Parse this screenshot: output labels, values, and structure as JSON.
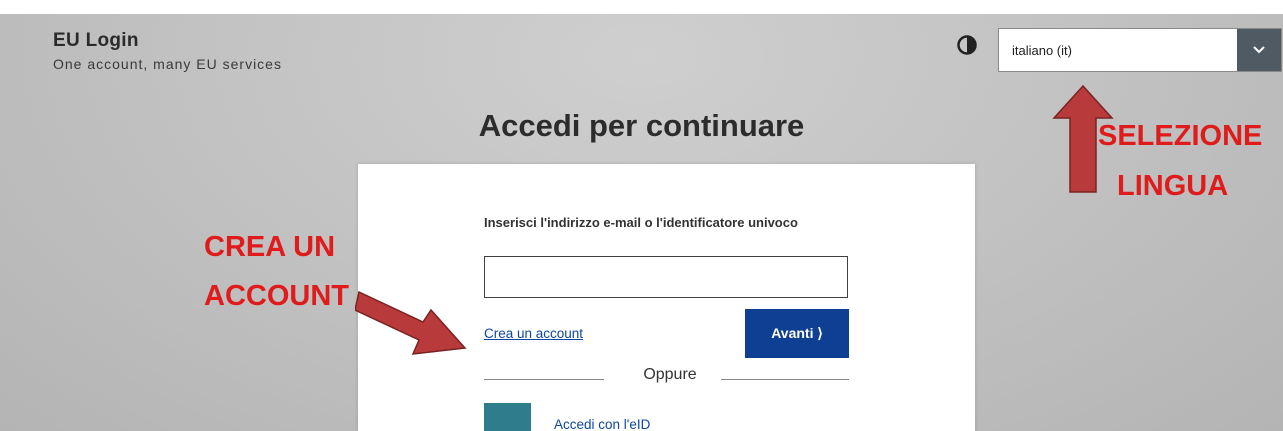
{
  "header": {
    "app_title": "EU Login",
    "tagline": "One account, many EU services",
    "contrast_icon": "contrast-icon",
    "language": {
      "selected": "italiano (it)",
      "icon": "chevron-down-icon"
    }
  },
  "main": {
    "heading": "Accedi per continuare",
    "login_card": {
      "field_label": "Inserisci l'indirizzo e-mail o l'identificatore univoco",
      "field_value": "",
      "create_account_link": "Crea un account",
      "next_button": "Avanti ⟩",
      "divider_text": "Oppure",
      "eid_icon": "globe-icon",
      "eid_link": "Accedi con l'eID"
    }
  },
  "annotations": {
    "create_account_line1": "CREA UN",
    "create_account_line2": "ACCOUNT",
    "language_line1": "SELEZIONE",
    "language_line2": "LINGUA",
    "color": "#e01b1b",
    "arrow_color": "#b83a3a"
  },
  "colors": {
    "primary_button": "#0e3f93",
    "link": "#0e47a1",
    "eid_tile": "#2e7d8c",
    "select_chevron_bg": "#505a62"
  }
}
